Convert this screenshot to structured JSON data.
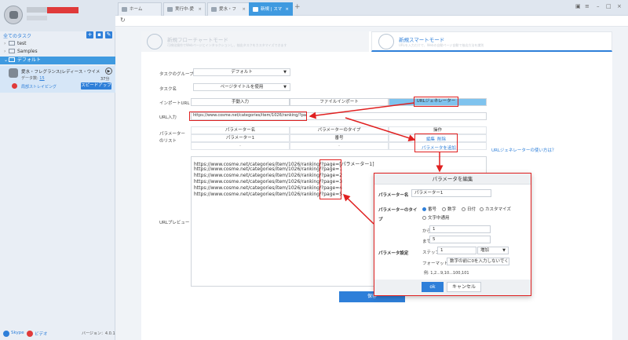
{
  "sidebar": {
    "all_tasks": "全てのタスク",
    "tree": [
      {
        "label": "test"
      },
      {
        "label": "Samples"
      },
      {
        "label": "デフォルト"
      }
    ],
    "task": {
      "title": "愛水・フレグランス(レディース・ウイメン",
      "count_label": "データ数:",
      "count": "15",
      "time": "37分",
      "local_run": "局部ストレイピング",
      "speed_up": "スピードアップ"
    },
    "bottom": {
      "skype": "Skype",
      "video": "ビデオ",
      "version": "バージョン：4.0.1"
    }
  },
  "tabs": [
    {
      "label": "ホーム"
    },
    {
      "label": "実行中-愛"
    },
    {
      "label": "愛水・フ"
    },
    {
      "label": "新規 | スマ"
    }
  ],
  "modes": {
    "flowchart_title": "新規フローチャートモード",
    "flowchart_desc": "可視化操作でWebページとインタラクションし、抽出タスクをカスタマイズできます",
    "smart_title": "新規スマートモード",
    "smart_desc": "URLを入力だけで、Webの自動ページ自動で抽出方法を識別"
  },
  "form": {
    "task_group_label": "タスクのグループ",
    "task_group_value": "デフォルト",
    "task_name_label": "タスク名",
    "task_name_value": "ページタイトルを使用",
    "import_url_label": "インポートURL",
    "import_options": [
      "手動入力",
      "ファイルインポート",
      "URLジェネレーター"
    ],
    "url_input_label": "URL入力",
    "url_value": "https://www.cosme.net/categories/item/1026/ranking/?page=",
    "param_list_label": "パラメーターのリスト",
    "param_headers": [
      "パラメーター名",
      "パラメーターのタイプ",
      "操作"
    ],
    "param_row": [
      "パラメーター1",
      "番号"
    ],
    "param_ops": [
      "編集",
      "削除"
    ],
    "add_param": "パラメータを追加",
    "url_gen_help": "URLジェネレーターの使い方は？",
    "url_preview_label": "URLプレビュー",
    "preview_lines": [
      "https://www.cosme.net/categories/item/1026/ranking/?page=[パラメーター1]",
      "https://www.cosme.net/categories/item/1026/ranking/?page=1",
      "https://www.cosme.net/categories/item/1026/ranking/?page=2",
      "https://www.cosme.net/categories/item/1026/ranking/?page=3",
      "https://www.cosme.net/categories/item/1026/ranking/?page=4",
      "https://www.cosme.net/categories/item/1026/ranking/?page=5"
    ],
    "save": "保存"
  },
  "dialog": {
    "title": "パラメータを編集",
    "name_label": "パラメーター名",
    "name_value": "パラメーター1",
    "type_label": "パラメーターのタイプ",
    "types": [
      "番号",
      "数字",
      "日付",
      "カスタマイズ",
      "文字中通用"
    ],
    "setting_label": "パラメータ設定",
    "from_label": "から",
    "from_value": "1",
    "to_label": "まで",
    "to_value": "5",
    "step_label": "ステップ",
    "step_value": "1",
    "step_mode": "増加",
    "format_label": "フォーマット",
    "format_value": "数字の前に0を入力しないでください",
    "example": "例: 1,2...9,10...100,101",
    "ok": "ok",
    "cancel": "キャンセル"
  },
  "colors": {
    "accent": "#2e7fd9",
    "highlight": "#e02020",
    "selected_tab": "#3f9ae0"
  }
}
